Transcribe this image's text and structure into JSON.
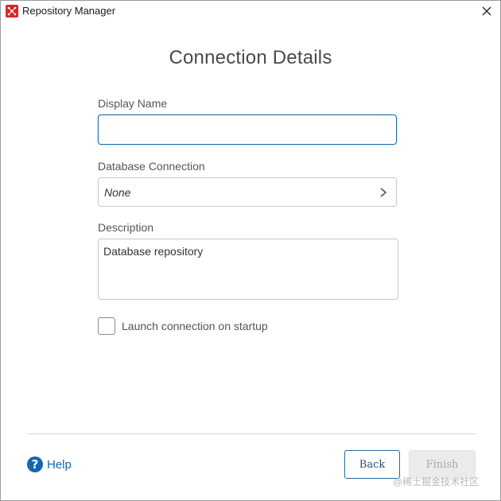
{
  "window": {
    "title": "Repository Manager",
    "icon": "app-logo-icon",
    "close_icon": "close-icon"
  },
  "page": {
    "heading": "Connection Details"
  },
  "form": {
    "display_name": {
      "label": "Display Name",
      "value": "",
      "placeholder": ""
    },
    "database_connection": {
      "label": "Database Connection",
      "value": "None",
      "icon": "chevron-right-icon"
    },
    "description": {
      "label": "Description",
      "value": "Database repository"
    },
    "launch_on_startup": {
      "label": "Launch connection on startup",
      "checked": false
    }
  },
  "footer": {
    "help_label": "Help",
    "help_icon": "question-circle-icon",
    "back_label": "Back",
    "finish_label": "Finish",
    "finish_enabled": false
  },
  "watermark": "@稀土掘金技术社区",
  "colors": {
    "accent": "#1f6fa8",
    "help_blue": "#1565b0",
    "app_icon_red": "#d8262b",
    "disabled_bg": "#ebebeb",
    "disabled_text": "#a8a8a8"
  }
}
